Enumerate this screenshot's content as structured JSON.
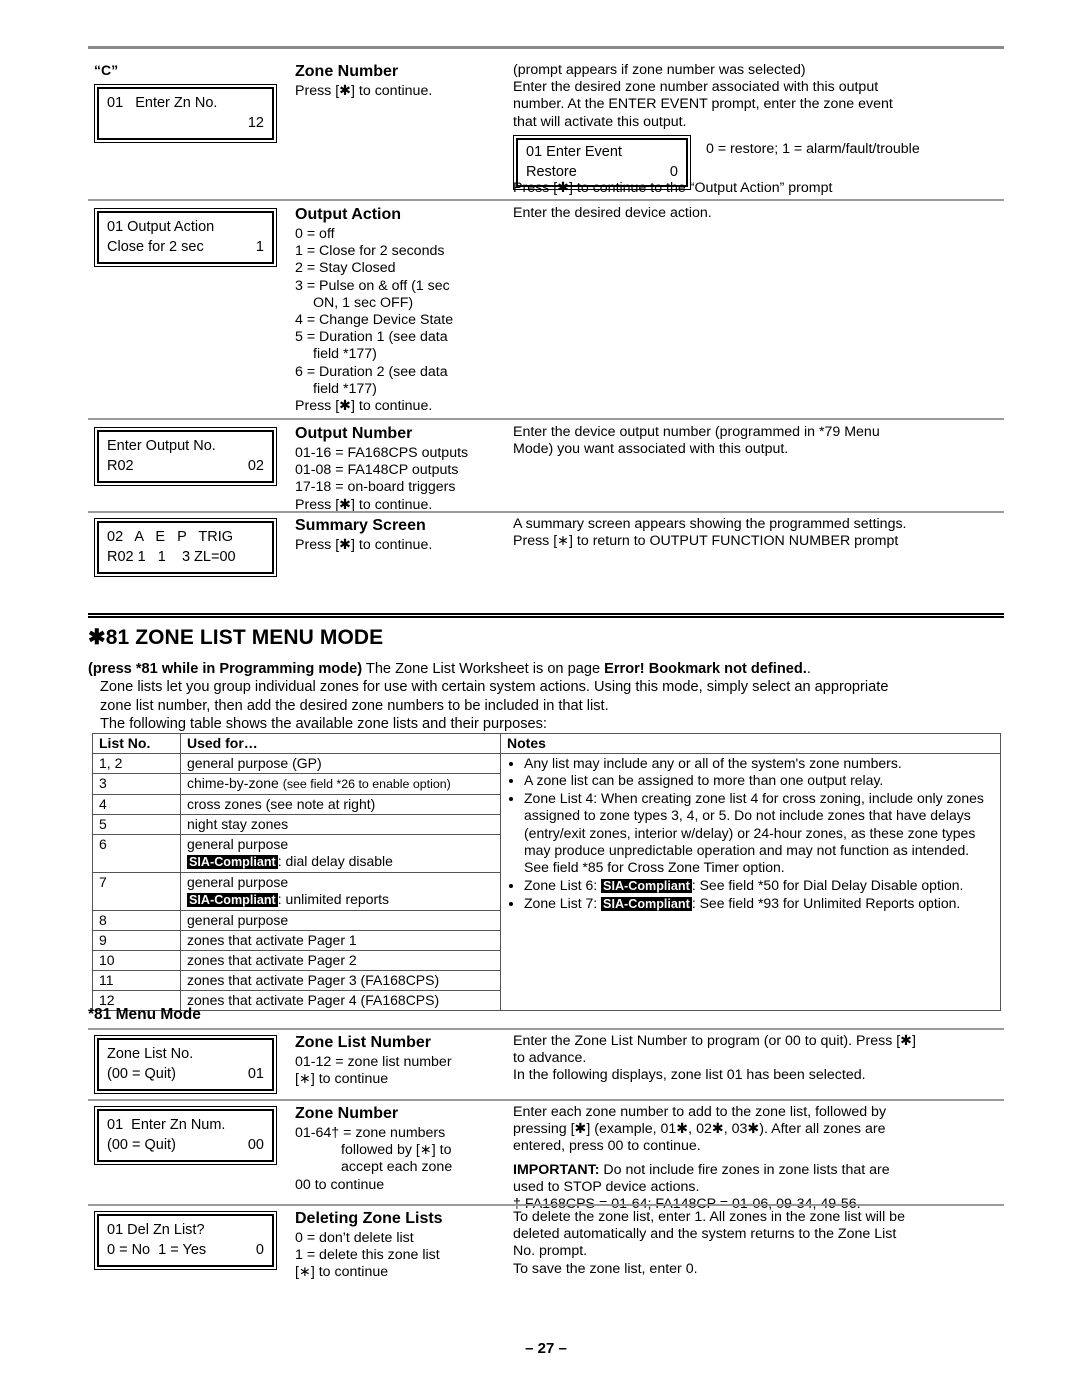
{
  "document": {
    "page_number": "– 27 –"
  },
  "section_top": {
    "label_c": "“C”",
    "rows": [
      {
        "lcd": {
          "line1_left": "01   Enter Zn No.",
          "line1_right": "",
          "line2_left": "",
          "line2_right": "12"
        },
        "title": "Zone Number",
        "sub_lines": [
          "Press [✱] to continue."
        ],
        "desc_lines": [
          "(prompt appears if zone number was selected)",
          "Enter the desired zone number associated with this output",
          "number. At the ENTER EVENT prompt, enter the zone event",
          "that will activate this output."
        ],
        "inline_lcd": {
          "line1": "01 Enter Event",
          "line2_left": "Restore",
          "line2_right": "0"
        },
        "inline_note": "0 = restore; 1 = alarm/fault/trouble",
        "desc_tail": "Press [✱] to continue to the “Output Action” prompt"
      },
      {
        "lcd": {
          "line1_left": "01 Output Action",
          "line1_right": "",
          "line2_left": "Close for 2 sec",
          "line2_right": "1"
        },
        "title": "Output Action",
        "sub_lines": [
          "0 = off",
          "1 = Close for 2 seconds",
          "2 = Stay Closed",
          "3 = Pulse on & off (1 sec",
          "ON, 1 sec OFF)",
          "4 = Change Device State",
          "5 = Duration 1 (see data",
          "field *177)",
          "6 = Duration 2 (see data",
          "field *177)",
          "Press [✱] to continue."
        ],
        "desc_lines": [
          "Enter the desired device action."
        ]
      },
      {
        "lcd": {
          "line1_left": "Enter Output No.",
          "line1_right": "",
          "line2_left": "R02",
          "line2_right": "02"
        },
        "title": "Output Number",
        "sub_lines": [
          "01-16 = FA168CPS outputs",
          "01-08 = FA148CP outputs",
          "17-18 = on-board triggers",
          "Press [✱] to continue."
        ],
        "desc_lines": [
          "Enter the device output number (programmed in *79 Menu",
          "Mode) you want associated with this output."
        ]
      },
      {
        "lcd": {
          "line1_left": "02   A   E   P   TRIG",
          "line1_right": "",
          "line2_left": "R02 1   1    3 ZL=00",
          "line2_right": ""
        },
        "title": "Summary Screen",
        "sub_lines": [
          "Press [✱] to continue."
        ],
        "desc_lines": [
          "A summary screen appears showing the programmed settings.",
          "Press [∗] to return to OUTPUT FUNCTION NUMBER prompt"
        ]
      }
    ]
  },
  "zone_list_section": {
    "heading": "✱81 ZONE LIST MENU MODE",
    "intro_bold": "(press *81 while in Programming mode)",
    "intro_rest_1": "  The Zone List Worksheet is on page ",
    "intro_bold_2": "Error! Bookmark not defined.",
    "intro_rest_2": ".",
    "intro_p2_line1": "Zone lists let you group individual zones for use with certain system actions. Using this mode, simply select an appropriate",
    "intro_p2_line2": "zone list number, then add the desired zone numbers to be included in that list.",
    "intro_p3": "The following table shows the available zone lists and their purposes:",
    "table": {
      "headers": [
        "List No.",
        "Used for…",
        "Notes"
      ],
      "rows": [
        {
          "no": "1, 2",
          "used_main": "general purpose (GP)",
          "used_small": "",
          "sia": "",
          "sia_tail": ""
        },
        {
          "no": "3",
          "used_main": "chime-by-zone ",
          "used_small": "(see field *26 to enable option)",
          "sia": "",
          "sia_tail": ""
        },
        {
          "no": "4",
          "used_main": "cross zones (see note at right)",
          "used_small": "",
          "sia": "",
          "sia_tail": ""
        },
        {
          "no": "5",
          "used_main": "night stay zones",
          "used_small": "",
          "sia": "",
          "sia_tail": ""
        },
        {
          "no": "6",
          "used_main": "general purpose",
          "used_small": "",
          "sia": "SIA-Compliant",
          "sia_tail": ": dial delay disable"
        },
        {
          "no": "7",
          "used_main": "general purpose",
          "used_small": "",
          "sia": "SIA-Compliant",
          "sia_tail": ": unlimited reports"
        },
        {
          "no": "8",
          "used_main": "general purpose",
          "used_small": "",
          "sia": "",
          "sia_tail": ""
        },
        {
          "no": "9",
          "used_main": "zones that activate Pager 1",
          "used_small": "",
          "sia": "",
          "sia_tail": ""
        },
        {
          "no": "10",
          "used_main": "zones that activate Pager 2",
          "used_small": "",
          "sia": "",
          "sia_tail": ""
        },
        {
          "no": "11",
          "used_main": "zones that activate Pager 3 (FA168CPS)",
          "used_small": "",
          "sia": "",
          "sia_tail": ""
        },
        {
          "no": "12",
          "used_main": "zones that activate Pager 4 (FA168CPS)",
          "used_small": "",
          "sia": "",
          "sia_tail": ""
        }
      ],
      "notes": {
        "bullet1": "Any list may include any or all of the system's zone numbers.",
        "bullet2": "A zone list can be assigned to more than one output relay.",
        "bullet3": "Zone List 4: When creating zone list 4 for cross zoning, include only zones assigned to zone types 3, 4, or 5. Do not include zones that have delays (entry/exit zones, interior w/delay) or 24-hour zones, as these zone types may produce unpredictable operation and may not function as intended. See field *85 for Cross Zone Timer option.",
        "bullet4_pre": "Zone List 6: ",
        "bullet4_sia": "SIA-Compliant",
        "bullet4_post": ": See field *50 for Dial Delay Disable option.",
        "bullet5_pre": "Zone List 7: ",
        "bullet5_sia": "SIA-Compliant",
        "bullet5_post": ": See field *93 for Unlimited Reports option."
      }
    }
  },
  "menu_mode": {
    "subhead": "*81 Menu Mode",
    "rows": [
      {
        "lcd": {
          "line1_left": "Zone List No.",
          "line1_right": "",
          "line2_left": "(00 = Quit)",
          "line2_right": "01"
        },
        "title": "Zone List Number",
        "sub_lines": [
          "01-12 = zone list number",
          "[∗] to continue"
        ],
        "desc_lines": [
          "Enter the Zone List Number to program (or 00 to quit). Press [✱]",
          "to advance.",
          "In the following displays, zone list 01 has been selected."
        ]
      },
      {
        "lcd": {
          "line1_left": "01  Enter Zn Num.",
          "line1_right": "",
          "line2_left": "(00 = Quit)",
          "line2_right": "00"
        },
        "title": "Zone Number",
        "sub_lines": [
          "01-64† = zone numbers",
          "followed by [∗] to",
          "accept each zone",
          "00 to continue"
        ],
        "desc_lines": [
          "Enter each zone number to add to the zone list, followed by",
          "pressing [✱] (example, 01✱, 02✱, 03✱). After all zones are",
          "entered, press 00 to continue."
        ],
        "desc_important_bold": "IMPORTANT:",
        "desc_important_rest": " Do not include fire zones in zone lists that are",
        "desc_important_line2": "used to STOP device actions.",
        "desc_footnote": "† FA168CPS = 01-64; FA148CP = 01-06, 09-34, 49-56."
      },
      {
        "lcd": {
          "line1_left": "01 Del Zn List?",
          "line1_right": "",
          "line2_left": "0 = No  1 = Yes",
          "line2_right": "0"
        },
        "title": "Deleting Zone Lists",
        "sub_lines": [
          "0 = don’t delete list",
          "1 = delete this zone list",
          "[∗] to continue"
        ],
        "desc_lines": [
          "To delete the zone list, enter 1. All zones in the zone list will be",
          "deleted automatically and the system returns to the Zone List",
          "No. prompt.",
          "To save the zone list, enter 0."
        ]
      }
    ]
  }
}
